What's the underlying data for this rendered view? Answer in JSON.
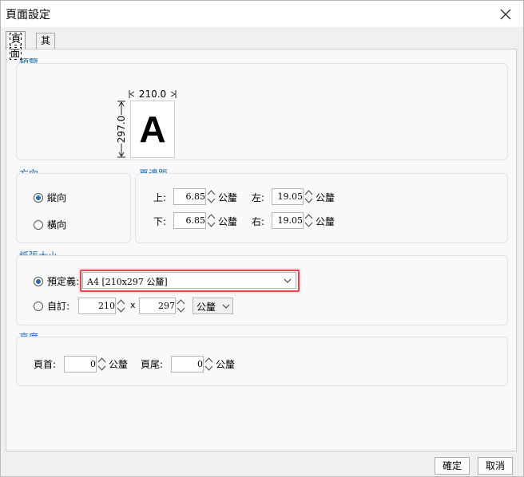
{
  "window": {
    "title": "頁面設定"
  },
  "tabs": [
    {
      "label": "頁面",
      "active": true
    },
    {
      "label": "其他",
      "active": false
    }
  ],
  "preview": {
    "group_label": "預覽",
    "width_value": "210.0",
    "height_value": "297.0",
    "sample_letter": "A"
  },
  "orientation": {
    "group_label": "方向",
    "options": [
      {
        "label": "縱向",
        "checked": true
      },
      {
        "label": "橫向",
        "checked": false
      }
    ]
  },
  "margins": {
    "group_label": "頁邊距",
    "unit": "公釐",
    "top": {
      "label": "上:",
      "value": "6.85"
    },
    "bottom": {
      "label": "下:",
      "value": "6.85"
    },
    "left": {
      "label": "左:",
      "value": "19.05"
    },
    "right": {
      "label": "右:",
      "value": "19.05"
    }
  },
  "paper_size": {
    "group_label": "紙張大小",
    "predefined": {
      "label": "預定義:",
      "checked": true,
      "selected": "A4 [210x297 公釐]"
    },
    "custom": {
      "label": "自訂:",
      "checked": false,
      "width": "210",
      "times": "x",
      "height": "297",
      "unit": "公釐"
    }
  },
  "height": {
    "group_label": "高度",
    "unit": "公釐",
    "header": {
      "label": "頁首:",
      "value": "0"
    },
    "footer": {
      "label": "頁尾:",
      "value": "0"
    }
  },
  "buttons": {
    "ok": "確定",
    "cancel": "取消"
  },
  "colors": {
    "accent": "#1f6db5",
    "highlight": "#e14b4b"
  }
}
